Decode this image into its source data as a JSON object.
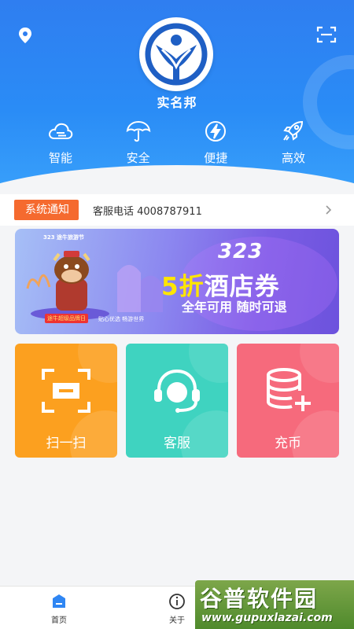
{
  "header": {
    "app_name": "实名邦",
    "features": [
      {
        "label": "智能",
        "icon": "cloud-icon"
      },
      {
        "label": "安全",
        "icon": "umbrella-icon"
      },
      {
        "label": "便捷",
        "icon": "lightning-icon"
      },
      {
        "label": "高效",
        "icon": "rocket-icon"
      }
    ]
  },
  "notice": {
    "tag": "系统通知",
    "text": "客服电话 4008787911"
  },
  "banner": {
    "logo_text": "323 途牛旅游节",
    "tag": "途牛超级品牌日",
    "subtitle": "贴心优选 畅游世界",
    "number": "323",
    "title_highlight": "5折",
    "title_rest": "酒店券",
    "note": "全年可用 随时可退"
  },
  "tiles": [
    {
      "label": "扫一扫",
      "icon": "scan-frame-icon",
      "color": "#fca01f"
    },
    {
      "label": "客服",
      "icon": "headset-icon",
      "color": "#3fd3c0"
    },
    {
      "label": "充币",
      "icon": "coin-stack-icon",
      "color": "#f66a7c"
    }
  ],
  "bottom_nav": [
    {
      "label": "首页",
      "icon": "home-icon",
      "active": true
    },
    {
      "label": "关于",
      "icon": "info-icon",
      "active": false
    }
  ],
  "watermark": {
    "name": "谷普软件园",
    "url": "www.gupuxlazai.com"
  },
  "colors": {
    "header_blue": "#2f7ef0",
    "notice_orange": "#f56a2f",
    "tile_orange": "#fca01f",
    "tile_teal": "#3fd3c0",
    "tile_pink": "#f66a7c"
  }
}
